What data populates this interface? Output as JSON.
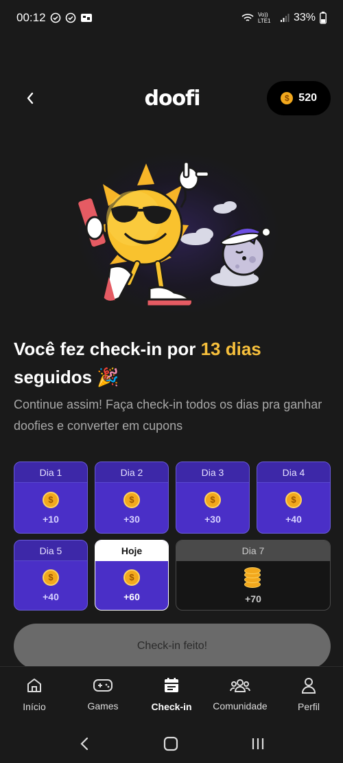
{
  "status_bar": {
    "time": "00:12",
    "network": "Vo)) LTE1",
    "battery": "33%"
  },
  "header": {
    "logo": "doofi",
    "coins": "520"
  },
  "hero": {
    "title_prefix": "Você fez check-in por ",
    "title_highlight": "13 dias",
    "title_suffix": "seguidos 🎉",
    "subtitle": "Continue assim! Faça check-in todos os dias pra ganhar doofies e converter em cupons"
  },
  "days": [
    {
      "label": "Dia 1",
      "reward": "+10",
      "state": "done"
    },
    {
      "label": "Dia 2",
      "reward": "+30",
      "state": "done"
    },
    {
      "label": "Dia 3",
      "reward": "+30",
      "state": "done"
    },
    {
      "label": "Dia 4",
      "reward": "+40",
      "state": "done"
    },
    {
      "label": "Dia 5",
      "reward": "+40",
      "state": "done"
    },
    {
      "label": "Hoje",
      "reward": "+60",
      "state": "today"
    },
    {
      "label": "Dia 7",
      "reward": "+70",
      "state": "future"
    }
  ],
  "checkin_button": "Check-in feito!",
  "tabs": [
    {
      "label": "Início",
      "icon": "home-icon"
    },
    {
      "label": "Games",
      "icon": "gamepad-icon"
    },
    {
      "label": "Check-in",
      "icon": "calendar-icon"
    },
    {
      "label": "Comunidade",
      "icon": "community-icon"
    },
    {
      "label": "Perfil",
      "icon": "profile-icon"
    }
  ],
  "colors": {
    "background": "#1a1a1a",
    "accent_purple": "#4a2fc7",
    "highlight_yellow": "#f7c03c",
    "coin": "#f2a81d"
  }
}
